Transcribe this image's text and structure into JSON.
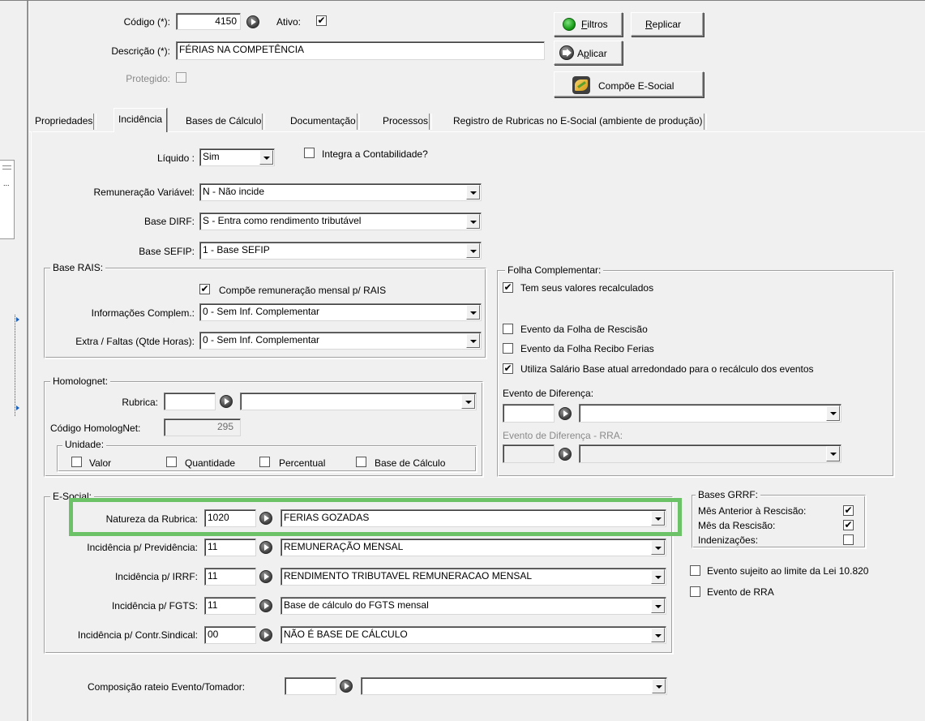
{
  "header": {
    "codigo_label": "Código (*):",
    "codigo_value": "4150",
    "ativo_label": "Ativo:",
    "ativo_checked": "✔",
    "descricao_label": "Descrição (*):",
    "descricao_value": "FÉRIAS NA COMPETÊNCIA",
    "protegido_label": "Protegido:",
    "btn_filtros_u": "F",
    "btn_filtros_rest": "iltros",
    "btn_replicar_u": "R",
    "btn_replicar_rest": "eplicar",
    "btn_aplicar_pre": "A",
    "btn_aplicar_u": "p",
    "btn_aplicar_rest": "licar",
    "btn_compoe": "Compõe E-Social"
  },
  "tabs": [
    {
      "label": "Propriedades"
    },
    {
      "label": "Incidência"
    },
    {
      "label": "Bases de Cálculo"
    },
    {
      "label": "Documentação"
    },
    {
      "label": "Processos"
    },
    {
      "label": "Registro de Rubricas no E-Social (ambiente de produção)"
    }
  ],
  "incidencia": {
    "liquido_label": "Líquido :",
    "liquido_value": "Sim",
    "integra_label": "Integra a Contabilidade?",
    "remuneracao_label": "Remuneração Variável:",
    "remuneracao_value": "N - Não incide",
    "dirf_label": "Base DIRF:",
    "dirf_value": "S - Entra como rendimento tributável",
    "sefip_label": "Base SEFIP:",
    "sefip_value": "1 - Base SEFIP"
  },
  "rais": {
    "title": "Base RAIS:",
    "compoe_label": "Compõe remuneração mensal p/ RAIS",
    "compoe_checked": "✔",
    "info_label": "Informações Complem.:",
    "info_value": "0 - Sem Inf. Complementar",
    "extra_label": "Extra / Faltas (Qtde Horas):",
    "extra_value": "0 - Sem Inf. Complementar"
  },
  "homolognet": {
    "title": "Homolognet:",
    "rubrica_label": "Rubrica:",
    "codigo_label": "Código HomologNet:",
    "codigo_value": "295",
    "unidade_title": "Unidade:",
    "valor_label": "Valor",
    "quantidade_label": "Quantidade",
    "percentual_label": "Percentual",
    "base_label": "Base de Cálculo"
  },
  "folha": {
    "title": "Folha Complementar:",
    "recalc_label": "Tem seus valores recalculados",
    "recalc_checked": "✔",
    "rescisao_label": "Evento da Folha de Rescisão",
    "ferias_label": "Evento da Folha Recibo Ferias",
    "salario_label": "Utiliza Salário Base atual arredondado para o recálculo dos eventos",
    "salario_checked": "✔",
    "diferenca_label": "Evento de Diferença:",
    "diferenca_rra_label": "Evento de Diferença - RRA:"
  },
  "esocial": {
    "title": "E-Social:",
    "rows": [
      {
        "label": "Natureza da Rubrica:",
        "code": "1020",
        "desc": "FERIAS GOZADAS"
      },
      {
        "label": "Incidência p/ Previdência:",
        "code": "11",
        "desc": "REMUNERAÇÃO MENSAL"
      },
      {
        "label": "Incidência p/ IRRF:",
        "code": "11",
        "desc": "RENDIMENTO TRIBUTAVEL REMUNERACAO MENSAL"
      },
      {
        "label": "Incidência p/ FGTS:",
        "code": "11",
        "desc": "Base de cálculo do FGTS mensal"
      },
      {
        "label": "Incidência p/ Contr.Sindical:",
        "code": "00",
        "desc": "NÃO É BASE DE CÁLCULO"
      }
    ],
    "highlight_color": "#6cc266"
  },
  "grrf": {
    "title": "Bases GRRF:",
    "anterior_label": "Mês Anterior à Rescisão:",
    "anterior_checked": "✔",
    "rescisao_label": "Mês da Rescisão:",
    "rescisao_checked": "✔",
    "indenizacoes_label": "Indenizações:",
    "limite_label": "Evento sujeito ao limite da Lei 10.820",
    "rra_label": "Evento de RRA"
  },
  "rateio": {
    "label": "Composição rateio Evento/Tomador:"
  }
}
